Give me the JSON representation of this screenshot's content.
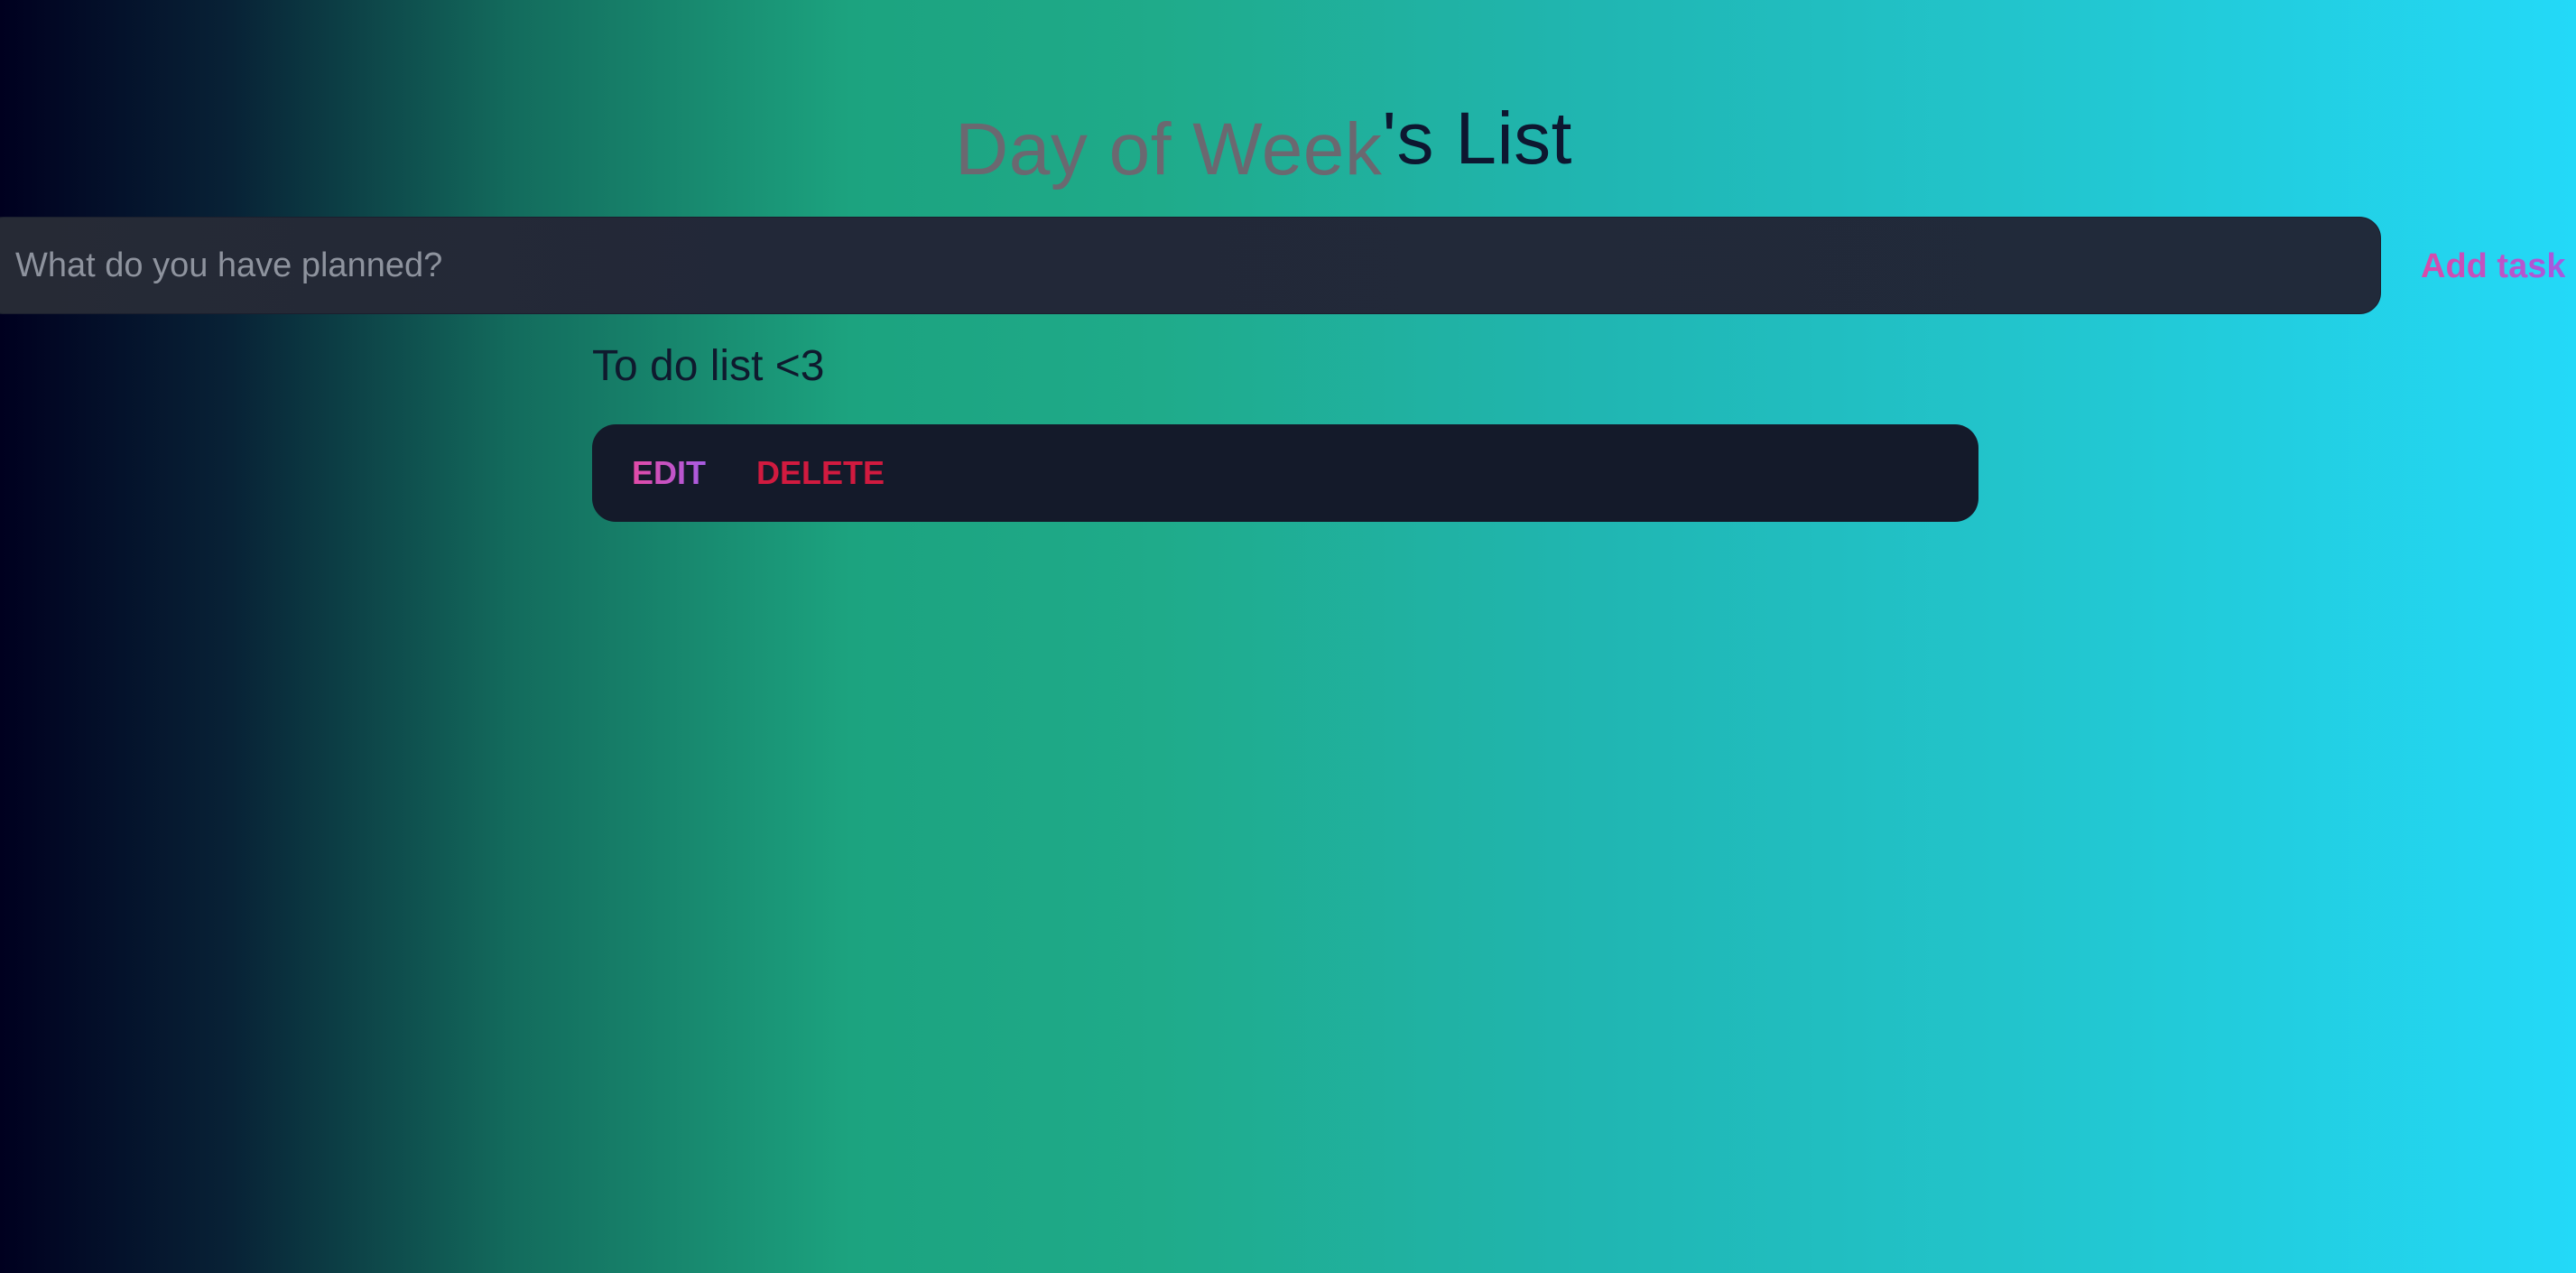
{
  "header": {
    "day_name": "Day of Week",
    "title_suffix": "'s List"
  },
  "task_form": {
    "input_value": "",
    "input_placeholder": "What do you have planned?",
    "add_label": "Add task"
  },
  "list": {
    "heading": "To do list <3",
    "tasks": [
      {
        "text": "",
        "edit_label": "EDIT",
        "delete_label": "DELETE"
      }
    ]
  },
  "colors": {
    "gradient_start": "#00001f",
    "gradient_mid": "#1ca37f",
    "gradient_end": "#23d9f8",
    "input_bg": "#222838",
    "card_bg": "#141a2a",
    "accent_pink": "#d94aa8",
    "accent_purple": "#a55ae0",
    "delete_red": "#d11a3f",
    "title_dark": "#0d1730",
    "title_gray": "#6b6870"
  }
}
